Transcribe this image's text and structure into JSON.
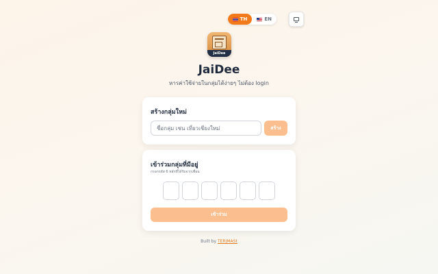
{
  "language": {
    "options": [
      {
        "code": "TH",
        "flag_icon": "thai-flag-icon",
        "active": true
      },
      {
        "code": "EN",
        "flag_icon": "uk-flag-icon",
        "active": false
      }
    ]
  },
  "display_toggle": {
    "icon": "monitor-icon"
  },
  "app": {
    "logo_text": "JaiDee",
    "title": "JaiDee",
    "subtitle": "หารค่าใช้จ่ายในกลุ่มได้ง่ายๆ ไม่ต้อง login"
  },
  "create_group": {
    "title": "สร้างกลุ่มใหม่",
    "input_placeholder": "ชื่อกลุ่ม เช่น เที่ยวเชียงใหม่",
    "input_value": "",
    "button_label": "สร้าง"
  },
  "join_group": {
    "title": "เข้าร่วมกลุ่มที่มีอยู่",
    "hint": "กรอกรหัส 6 หลักที่ได้รับจากเพื่อน",
    "code_digits": [
      "",
      "",
      "",
      "",
      "",
      ""
    ],
    "button_label": "เข้าร่วม"
  },
  "footer": {
    "prefix": "Built by",
    "link_text": "TERJMASt"
  },
  "colors": {
    "accent": "#f27a1a",
    "button_disabled": "#fbbf8f",
    "background": "#fdf4ea",
    "title_text": "#1e293b"
  }
}
